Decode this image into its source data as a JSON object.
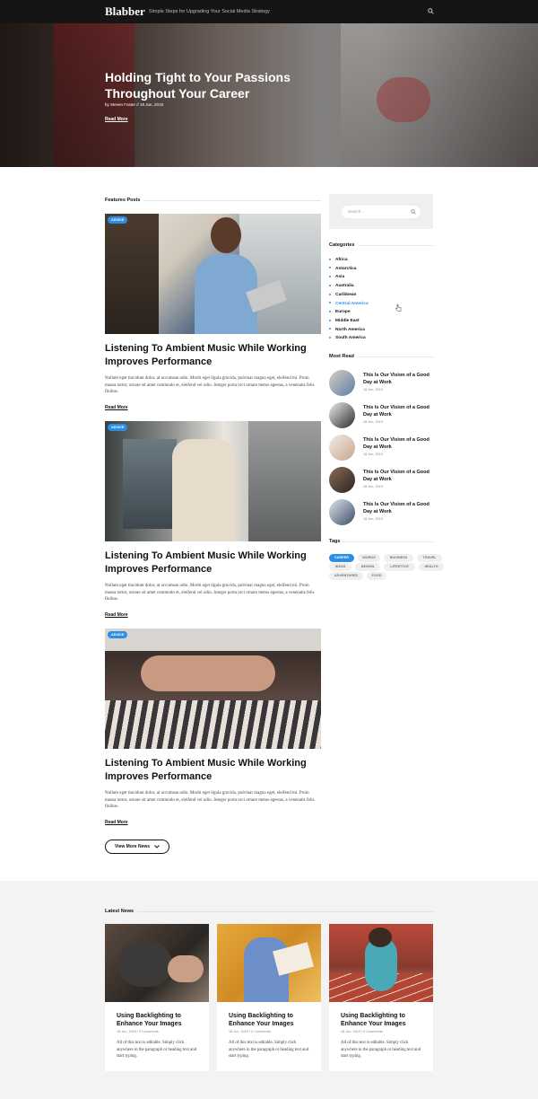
{
  "header": {
    "logo": "Blabber",
    "tagline": "Simple Steps for Upgrading Your Social Media Strategy",
    "search_icon": "search-icon"
  },
  "hero": {
    "title": "Holding Tight to Your Passions Throughout Your Career",
    "meta": "by Steven Foster  //  18 Jun, 2019",
    "read_more": "Read More"
  },
  "features": {
    "heading": "Features Posts",
    "posts": [
      {
        "badge": "ADVICE",
        "title": "Listening To Ambient Music While Working Improves Performance",
        "excerpt": "Nullam eget tincidunt dolor, at accumsan odio. Morbi eget ligula gravida, pulvinar magna eget, eleifend mi. Proin massa tortor, ornare sit amet commodo et, eleifend vel odio. Integer porta orci ornare metus egestas, a venenatis felis finibus.",
        "read_more": "Read More"
      },
      {
        "badge": "ADVICE",
        "title": "Listening To Ambient Music While Working Improves Performance",
        "excerpt": "Nullam eget tincidunt dolor, at accumsan odio. Morbi eget ligula gravida, pulvinar magna eget, eleifend mi. Proin massa tortor, ornare sit amet commodo et, eleifend vel odio. Integer porta orci ornare metus egestas, a venenatis felis finibus.",
        "read_more": "Read More"
      },
      {
        "badge": "ADVICE",
        "title": "Listening To Ambient Music While Working Improves Performance",
        "excerpt": "Nullam eget tincidunt dolor, at accumsan odio. Morbi eget ligula gravida, pulvinar magna eget, eleifend mi. Proin massa tortor, ornare sit amet commodo et, eleifend vel odio. Integer porta orci ornare metus egestas, a venenatis felis finibus.",
        "read_more": "Read More"
      }
    ],
    "view_more": "View More News"
  },
  "sidebar": {
    "search_placeholder": "Search...",
    "categories_heading": "Categories",
    "categories": [
      "Africa",
      "Antarctica",
      "Asia",
      "Australia",
      "Caribbean",
      "Central America",
      "Europe",
      "Middle East",
      "North America",
      "South America"
    ],
    "active_category": "Central America",
    "most_read_heading": "Most Read",
    "most_read": [
      {
        "title": "This Is Our Vision of a Good Day at Work",
        "date": "18 Jun, 2019"
      },
      {
        "title": "This Is Our Vision of a Good Day at Work",
        "date": "18 Jun, 2019"
      },
      {
        "title": "This Is Our Vision of a Good Day at Work",
        "date": "18 Jun, 2019"
      },
      {
        "title": "This Is Our Vision of a Good Day at Work",
        "date": "18 Jun, 2019"
      },
      {
        "title": "This Is Our Vision of a Good Day at Work",
        "date": "18 Jun, 2019"
      }
    ],
    "tags_heading": "Tags",
    "tags": [
      "CAREER",
      "WORKS",
      "BUSINESS",
      "TRAVEL",
      "IDEAS",
      "DESIGN",
      "LIFESTYLE",
      "HEALTH",
      "ADVENTURES",
      "FOOD"
    ],
    "active_tag": "CAREER"
  },
  "latest": {
    "heading": "Latest News",
    "cards": [
      {
        "title": "Using Backlighting to Enhance Your Images",
        "meta": "18 Jun, 2019  /  0 Comments",
        "body": "All of this text is editable. Simply click anywhere in the paragraph or heading text and start typing."
      },
      {
        "title": "Using Backlighting to Enhance Your Images",
        "meta": "18 Jun, 2019  /  0 Comments",
        "body": "All of this text is editable. Simply click anywhere in the paragraph or heading text and start typing."
      },
      {
        "title": "Using Backlighting to Enhance Your Images",
        "meta": "18 Jun, 2019  /  0 Comments",
        "body": "All of this text is editable. Simply click anywhere in the paragraph or heading text and start typing."
      }
    ]
  },
  "colors": {
    "accent": "#2b8fe6",
    "topbar": "#151515",
    "latest_bg": "#f3f3f3"
  }
}
